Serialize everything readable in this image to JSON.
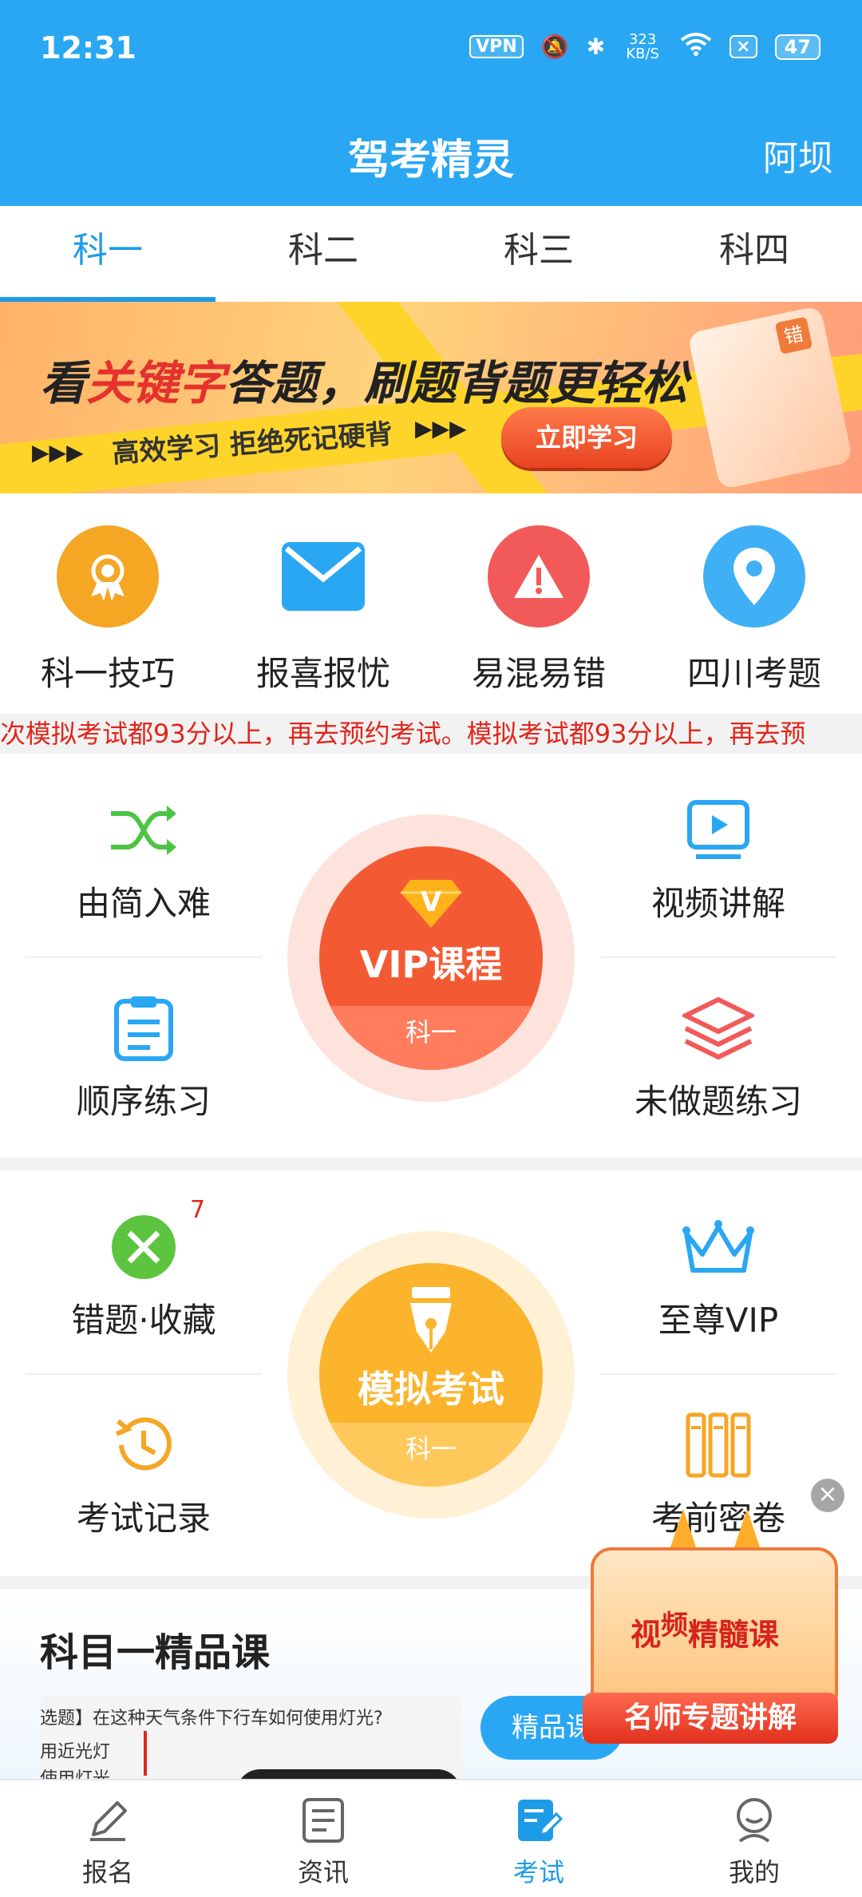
{
  "status_bar": {
    "time": "12:31",
    "vpn": "VPN",
    "speed": "323 KB/S",
    "battery": "47"
  },
  "header": {
    "title": "驾考精灵",
    "location": "阿坝"
  },
  "tabs": [
    {
      "label": "科一",
      "active": true
    },
    {
      "label": "科二",
      "active": false
    },
    {
      "label": "科三",
      "active": false
    },
    {
      "label": "科四",
      "active": false
    }
  ],
  "banner": {
    "headline_pre": "看",
    "headline_hl": "关键字",
    "headline_post": "答题，刷题背题更轻松",
    "subtitle": "高效学习 拒绝死记硬背",
    "button": "立即学习",
    "book_mark": "错",
    "arrows": "▶▶▶"
  },
  "quick_items": [
    {
      "label": "科一技巧",
      "color": "#f5a623",
      "icon": "award-medal-icon",
      "glyph": "✪"
    },
    {
      "label": "报喜报忧",
      "color": "#2aa7f3",
      "icon": "envelope-icon",
      "glyph": ""
    },
    {
      "label": "易混易错",
      "color": "#f25a5a",
      "icon": "warning-icon",
      "glyph": "!"
    },
    {
      "label": "四川考题",
      "color": "#3fb0f5",
      "icon": "location-pin-icon",
      "glyph": ""
    }
  ],
  "marquee": "次模拟考试都93分以上，再去预约考试。模拟考试都93分以上，再去预",
  "practice": {
    "top_left": "由简入难",
    "bottom_left": "顺序练习",
    "top_right": "视频讲解",
    "bottom_right": "未做题练习",
    "center_title": "VIP课程",
    "center_sub": "科一",
    "center_mark": "V"
  },
  "exam": {
    "top_left": "错题·收藏",
    "top_left_badge": "7",
    "bottom_left": "考试记录",
    "top_right": "至尊VIP",
    "bottom_right": "考前密卷",
    "center_title": "模拟考试",
    "center_sub": "科一"
  },
  "course": {
    "title": "科目一精品课",
    "thumb_line1": "选题】在这种天气条件下行车如何使用灯光?",
    "thumb_line2": "用近光灯",
    "thumb_line3": "使用灯光",
    "button": "精品课"
  },
  "promo": {
    "text_a": "视",
    "text_b": "频",
    "text_c": "精髓课",
    "ribbon": "名师专题讲解",
    "close": "×"
  },
  "bottom_nav": [
    {
      "label": "报名",
      "icon": "signup-pen-icon",
      "active": false
    },
    {
      "label": "资讯",
      "icon": "news-doc-icon",
      "active": false
    },
    {
      "label": "考试",
      "icon": "exam-edit-icon",
      "active": true
    },
    {
      "label": "我的",
      "icon": "user-profile-icon",
      "active": false
    }
  ]
}
